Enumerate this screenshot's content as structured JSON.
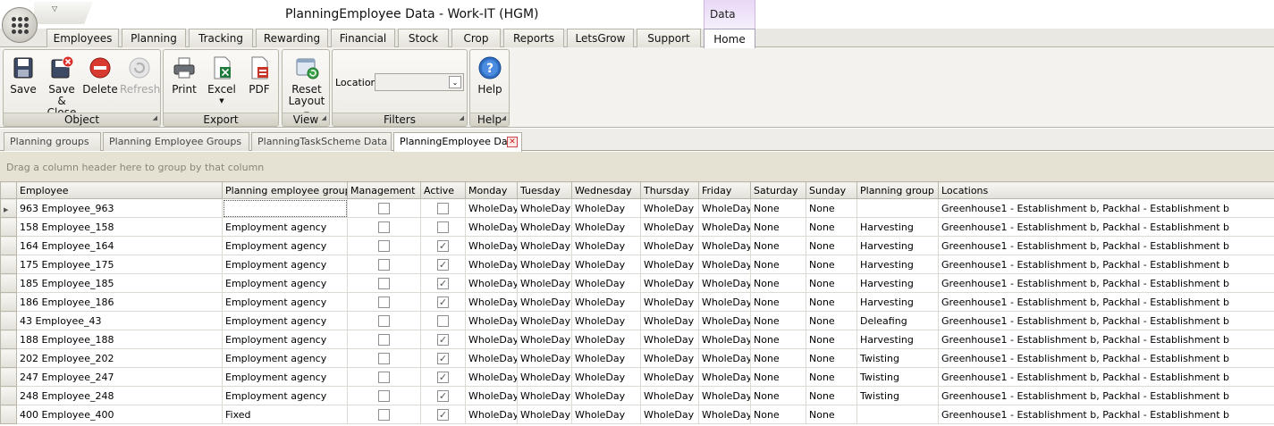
{
  "window": {
    "title": "PlanningEmployee Data - Work-IT (HGM)",
    "context_tab_group": "Data"
  },
  "ribbon_tabs": [
    {
      "label": "Employees"
    },
    {
      "label": "Planning"
    },
    {
      "label": "Tracking"
    },
    {
      "label": "Rewarding"
    },
    {
      "label": "Financial"
    },
    {
      "label": "Stock"
    },
    {
      "label": "Crop"
    },
    {
      "label": "Reports"
    },
    {
      "label": "LetsGrow"
    },
    {
      "label": "Support"
    },
    {
      "label": "Home",
      "active": true
    }
  ],
  "ribbon": {
    "object": {
      "label": "Object",
      "save": "Save",
      "save_close_1": "Save &",
      "save_close_2": "Close",
      "delete": "Delete",
      "refresh": "Refresh"
    },
    "export": {
      "label": "Export",
      "print": "Print",
      "excel": "Excel",
      "pdf": "PDF"
    },
    "view": {
      "label": "View",
      "reset_1": "Reset",
      "reset_2": "Layout"
    },
    "filters": {
      "label": "Filters",
      "location_label": "Location",
      "location_value": ""
    },
    "help": {
      "label": "Help",
      "help": "Help"
    }
  },
  "doc_tabs": [
    {
      "label": "Planning groups"
    },
    {
      "label": "Planning Employee Groups"
    },
    {
      "label": "PlanningTaskScheme Data"
    },
    {
      "label": "PlanningEmployee Data",
      "active": true
    }
  ],
  "group_panel_text": "Drag a column header here to group by that column",
  "columns": [
    "Employee",
    "Planning employee group",
    "Management",
    "Active",
    "Monday",
    "Tuesday",
    "Wednesday",
    "Thursday",
    "Friday",
    "Saturday",
    "Sunday",
    "Planning group",
    "Locations"
  ],
  "rows": [
    {
      "employee": "963 Employee_963",
      "group": "",
      "management": false,
      "active": false,
      "mon": "WholeDay",
      "tue": "WholeDay",
      "wed": "WholeDay",
      "thu": "WholeDay",
      "fri": "WholeDay",
      "sat": "None",
      "sun": "None",
      "pgroup": "",
      "locations": "Greenhouse1 - Establishment b, Packhal - Establishment b"
    },
    {
      "employee": "158 Employee_158",
      "group": "Employment agency",
      "management": false,
      "active": false,
      "mon": "WholeDay",
      "tue": "WholeDay",
      "wed": "WholeDay",
      "thu": "WholeDay",
      "fri": "WholeDay",
      "sat": "None",
      "sun": "None",
      "pgroup": "Harvesting",
      "locations": "Greenhouse1 - Establishment b, Packhal - Establishment b"
    },
    {
      "employee": "164 Employee_164",
      "group": "Employment agency",
      "management": false,
      "active": true,
      "mon": "WholeDay",
      "tue": "WholeDay",
      "wed": "WholeDay",
      "thu": "WholeDay",
      "fri": "WholeDay",
      "sat": "None",
      "sun": "None",
      "pgroup": "Harvesting",
      "locations": "Greenhouse1 - Establishment b, Packhal - Establishment b"
    },
    {
      "employee": "175 Employee_175",
      "group": "Employment agency",
      "management": false,
      "active": true,
      "mon": "WholeDay",
      "tue": "WholeDay",
      "wed": "WholeDay",
      "thu": "WholeDay",
      "fri": "WholeDay",
      "sat": "None",
      "sun": "None",
      "pgroup": "Harvesting",
      "locations": "Greenhouse1 - Establishment b, Packhal - Establishment b"
    },
    {
      "employee": "185 Employee_185",
      "group": "Employment agency",
      "management": false,
      "active": true,
      "mon": "WholeDay",
      "tue": "WholeDay",
      "wed": "WholeDay",
      "thu": "WholeDay",
      "fri": "WholeDay",
      "sat": "None",
      "sun": "None",
      "pgroup": "Harvesting",
      "locations": "Greenhouse1 - Establishment b, Packhal - Establishment b"
    },
    {
      "employee": "186 Employee_186",
      "group": "Employment agency",
      "management": false,
      "active": true,
      "mon": "WholeDay",
      "tue": "WholeDay",
      "wed": "WholeDay",
      "thu": "WholeDay",
      "fri": "WholeDay",
      "sat": "None",
      "sun": "None",
      "pgroup": "Harvesting",
      "locations": "Greenhouse1 - Establishment b, Packhal - Establishment b"
    },
    {
      "employee": "43 Employee_43",
      "group": "Employment agency",
      "management": false,
      "active": false,
      "mon": "WholeDay",
      "tue": "WholeDay",
      "wed": "WholeDay",
      "thu": "WholeDay",
      "fri": "WholeDay",
      "sat": "None",
      "sun": "None",
      "pgroup": "Deleafing",
      "locations": "Greenhouse1 - Establishment b, Packhal - Establishment b"
    },
    {
      "employee": "188 Employee_188",
      "group": "Employment agency",
      "management": false,
      "active": true,
      "mon": "WholeDay",
      "tue": "WholeDay",
      "wed": "WholeDay",
      "thu": "WholeDay",
      "fri": "WholeDay",
      "sat": "None",
      "sun": "None",
      "pgroup": "Harvesting",
      "locations": "Greenhouse1 - Establishment b, Packhal - Establishment b"
    },
    {
      "employee": "202 Employee_202",
      "group": "Employment agency",
      "management": false,
      "active": true,
      "mon": "WholeDay",
      "tue": "WholeDay",
      "wed": "WholeDay",
      "thu": "WholeDay",
      "fri": "WholeDay",
      "sat": "None",
      "sun": "None",
      "pgroup": "Twisting",
      "locations": "Greenhouse1 - Establishment b, Packhal - Establishment b"
    },
    {
      "employee": "247 Employee_247",
      "group": "Employment agency",
      "management": false,
      "active": true,
      "mon": "WholeDay",
      "tue": "WholeDay",
      "wed": "WholeDay",
      "thu": "WholeDay",
      "fri": "WholeDay",
      "sat": "None",
      "sun": "None",
      "pgroup": "Twisting",
      "locations": "Greenhouse1 - Establishment b, Packhal - Establishment b"
    },
    {
      "employee": "248 Employee_248",
      "group": "Employment agency",
      "management": false,
      "active": true,
      "mon": "WholeDay",
      "tue": "WholeDay",
      "wed": "WholeDay",
      "thu": "WholeDay",
      "fri": "WholeDay",
      "sat": "None",
      "sun": "None",
      "pgroup": "Twisting",
      "locations": "Greenhouse1 - Establishment b, Packhal - Establishment b"
    },
    {
      "employee": "400 Employee_400",
      "group": "Fixed",
      "management": false,
      "active": true,
      "mon": "WholeDay",
      "tue": "WholeDay",
      "wed": "WholeDay",
      "thu": "WholeDay",
      "fri": "WholeDay",
      "sat": "None",
      "sun": "None",
      "pgroup": "",
      "locations": "Greenhouse1 - Establishment b, Packhal - Establishment b"
    }
  ]
}
